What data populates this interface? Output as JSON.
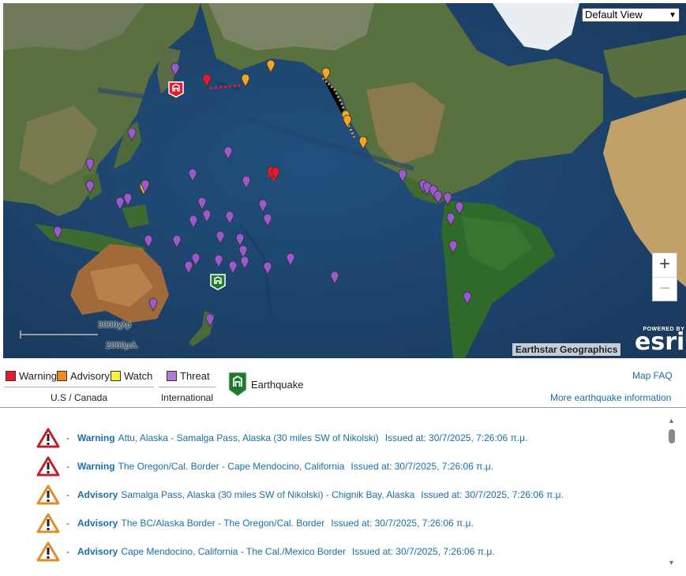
{
  "map": {
    "view_select": "Default View",
    "zoom_in": "+",
    "zoom_out": "−",
    "scale_top": "3000χλμ",
    "scale_bottom": "2000μιλ.",
    "attribution": "Earthstar Geographics",
    "powered_by": "POWERED BY",
    "esri": "esri",
    "colors": {
      "warning": "#e8192c",
      "advisory": "#f5a623",
      "watch": "#f7d117",
      "threat": "#9b59d0",
      "earthquake": "#1e7a2e"
    }
  },
  "legend": {
    "warning": "Warning",
    "advisory": "Advisory",
    "watch": "Watch",
    "threat": "Threat",
    "us_canada": "U.S / Canada",
    "international": "International",
    "earthquake": "Earthquake",
    "map_faq": "Map FAQ",
    "more_info": "More earthquake information"
  },
  "alerts": [
    {
      "level": "Warning",
      "region": "Attu, Alaska - Samalga Pass, Alaska (30 miles SW of Nikolski)",
      "issued": "Issued at: 30/7/2025, 7:26:06 π.μ."
    },
    {
      "level": "Warning",
      "region": "The Oregon/Cal. Border - Cape Mendocino, California",
      "issued": "Issued at: 30/7/2025, 7:26:06 π.μ."
    },
    {
      "level": "Advisory",
      "region": "Samalga Pass, Alaska (30 miles SW of Nikolski) - Chignik Bay, Alaska",
      "issued": "Issued at: 30/7/2025, 7:26:06 π.μ."
    },
    {
      "level": "Advisory",
      "region": "The BC/Alaska Border - The Oregon/Cal. Border",
      "issued": "Issued at: 30/7/2025, 7:26:06 π.μ."
    },
    {
      "level": "Advisory",
      "region": "Cape Mendocino, California - The Cal./Mexico Border",
      "issued": "Issued at: 30/7/2025, 7:26:06 π.μ."
    }
  ]
}
